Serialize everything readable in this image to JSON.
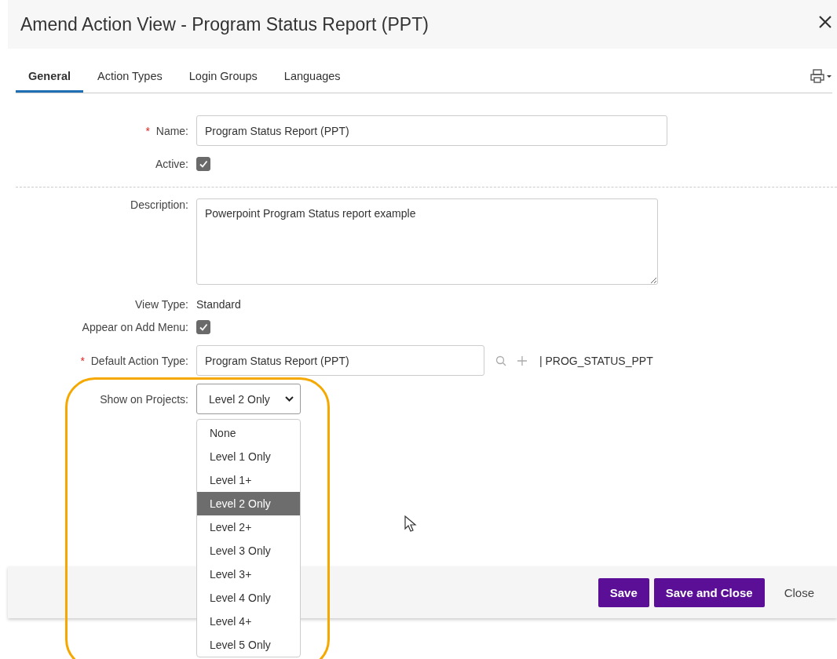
{
  "window": {
    "title": "Amend Action View - Program Status Report (PPT)"
  },
  "tabs": [
    {
      "label": "General",
      "selected": true
    },
    {
      "label": "Action Types",
      "selected": false
    },
    {
      "label": "Login Groups",
      "selected": false
    },
    {
      "label": "Languages",
      "selected": false
    }
  ],
  "fields": [
    {
      "kind": "text",
      "marker": "*",
      "label": "Name:",
      "value": "Program Status Report (PPT)"
    },
    {
      "kind": "checkbox",
      "label": "Active:",
      "checked": true
    },
    {
      "kind": "divider"
    },
    {
      "kind": "textarea",
      "label": "Description:",
      "value": "Powerpoint Program Status report example"
    },
    {
      "kind": "static",
      "label": "View Type:",
      "value": "Standard"
    },
    {
      "kind": "checkbox",
      "label": "Appear on Add Menu:",
      "checked": true
    },
    {
      "kind": "lookup",
      "marker": "*",
      "label": "Default Action Type:",
      "value": "Program Status Report (PPT)",
      "code": "| PROG_STATUS_PPT"
    },
    {
      "kind": "select",
      "label": "Show on Projects:",
      "value": "Level 2 Only",
      "expanded": true,
      "highlighted": true,
      "options": [
        {
          "label": "None",
          "selected": false
        },
        {
          "label": "Level 1 Only",
          "selected": false
        },
        {
          "label": "Level 1+",
          "selected": false
        },
        {
          "label": "Level 2 Only",
          "selected": true
        },
        {
          "label": "Level 2+",
          "selected": false
        },
        {
          "label": "Level 3 Only",
          "selected": false
        },
        {
          "label": "Level 3+",
          "selected": false
        },
        {
          "label": "Level 4 Only",
          "selected": false
        },
        {
          "label": "Level 4+",
          "selected": false
        },
        {
          "label": "Level 5 Only",
          "selected": false
        }
      ]
    }
  ],
  "footer": {
    "buttons": [
      {
        "label": "Save",
        "kind": "primary"
      },
      {
        "label": "Save and Close",
        "kind": "primary"
      },
      {
        "label": "Close",
        "kind": "plain"
      }
    ]
  }
}
